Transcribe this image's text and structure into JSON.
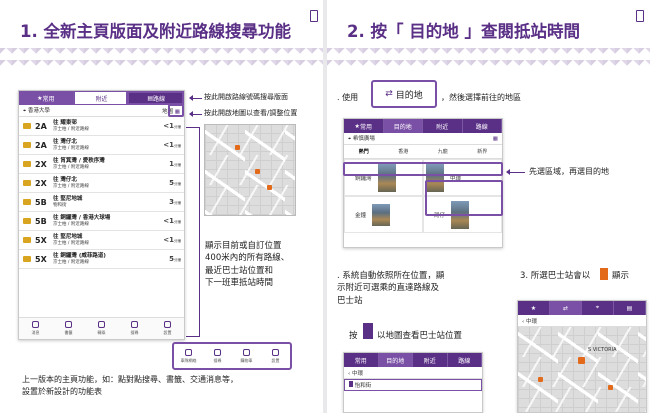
{
  "left": {
    "title": "1. 全新主頁版面及附近路線搜尋功能",
    "tabs": [
      "常用",
      "附近",
      "路線"
    ],
    "location": "香港大學",
    "map_label": "地圖",
    "routes": [
      {
        "num": "2A",
        "dest": "往 耀東邨",
        "sub": "京士柏 / 附近路線",
        "eta": "<1",
        "unit": "分鐘",
        "color": "#d9a520"
      },
      {
        "num": "2A",
        "dest": "往 灣仔北",
        "sub": "京士柏 / 附近路線",
        "eta": "<1",
        "unit": "分鐘",
        "color": "#d9a520"
      },
      {
        "num": "2X",
        "dest": "往 筲箕灣 / 愛秩序灣",
        "sub": "京士柏 / 附近路線",
        "eta": "1",
        "unit": "分鐘",
        "color": "#d9a520"
      },
      {
        "num": "2X",
        "dest": "往 灣仔北",
        "sub": "京士柏 / 附近路線",
        "eta": "5",
        "unit": "分鐘",
        "color": "#d9a520"
      },
      {
        "num": "5B",
        "dest": "往 堅尼地城",
        "sub": "物和街",
        "eta": "3",
        "unit": "分鐘",
        "color": "#d9a520"
      },
      {
        "num": "5B",
        "dest": "往 銅鑼灣 / 香港大球場",
        "sub": "京士柏 / 附近路線",
        "eta": "<1",
        "unit": "分鐘",
        "color": "#d9a520"
      },
      {
        "num": "5X",
        "dest": "往 堅尼地城",
        "sub": "京士柏 / 附近路線",
        "eta": "<1",
        "unit": "分鐘",
        "color": "#d9a520"
      },
      {
        "num": "5X",
        "dest": "往 銅鑼灣 (威菲路道)",
        "sub": "京士柏 / 附近路線",
        "eta": "5",
        "unit": "分鐘",
        "color": "#d9a520"
      }
    ],
    "nav": [
      "消息",
      "書籤",
      "轉乘",
      "搜尋",
      "設置"
    ],
    "nav2": [
      "車隊網絡",
      "搜尋",
      "購物車",
      "設置"
    ],
    "callouts": {
      "route_search": "按此開啟路線號碼搜尋版面",
      "map_view": "按此開啟地圖以查看/調整位置",
      "nearby": "顯示目前或自訂位置\n400米內的所有路線、\n最近巴士站位置和\n下一班車抵站時間",
      "footer": "上一版本的主頁功能，如：點對點搜尋、書籤、交通消息等，\n設置於新設計的功能表"
    }
  },
  "right": {
    "title": "2.  按「 目的地 」查閱抵站時間",
    "step1_prefix": ". 使用",
    "step1_button": "目的地",
    "step1_suffix": "，然後選擇前往的地區",
    "tabs": [
      "常用",
      "目的地",
      "附近",
      "路線"
    ],
    "location": "希慎廣場",
    "regions": [
      "熱門",
      "香港",
      "九龍",
      "新界"
    ],
    "areas": [
      "銅鑼灣",
      "中環",
      "金鐘",
      "灣仔"
    ],
    "region_callout": "先選區域，再選目的地",
    "step2": ". 系統自動依照所在位置，顯\n示附近可選乘的直達路線及\n巴士站",
    "step2b_prefix": "按",
    "step2b_suffix": "以地圖查看巴士站位置",
    "step3": "3. 所選巴士站會以",
    "step3_suffix": "顯示",
    "small_phone": {
      "tabs": [
        "常用",
        "目的地",
        "附近",
        "路線"
      ],
      "dest": "中環",
      "stop": "怡和街"
    },
    "map_phone": {
      "dest": "中環",
      "label": "S VICTORIA"
    }
  }
}
